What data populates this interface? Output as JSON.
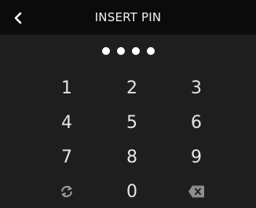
{
  "header": {
    "title": "INSERT PIN",
    "back_icon": "chevron-left-icon"
  },
  "pin": {
    "entered_count": 4
  },
  "keypad": {
    "keys": [
      "1",
      "2",
      "3",
      "4",
      "5",
      "6",
      "7",
      "8",
      "9",
      "0"
    ],
    "refresh_icon": "refresh-icon",
    "backspace_icon": "backspace-icon"
  },
  "colors": {
    "background": "#1e1e1e",
    "header_background": "#0b0b0b",
    "text": "#e6e6e6",
    "icon_muted": "#9a9a9a"
  }
}
